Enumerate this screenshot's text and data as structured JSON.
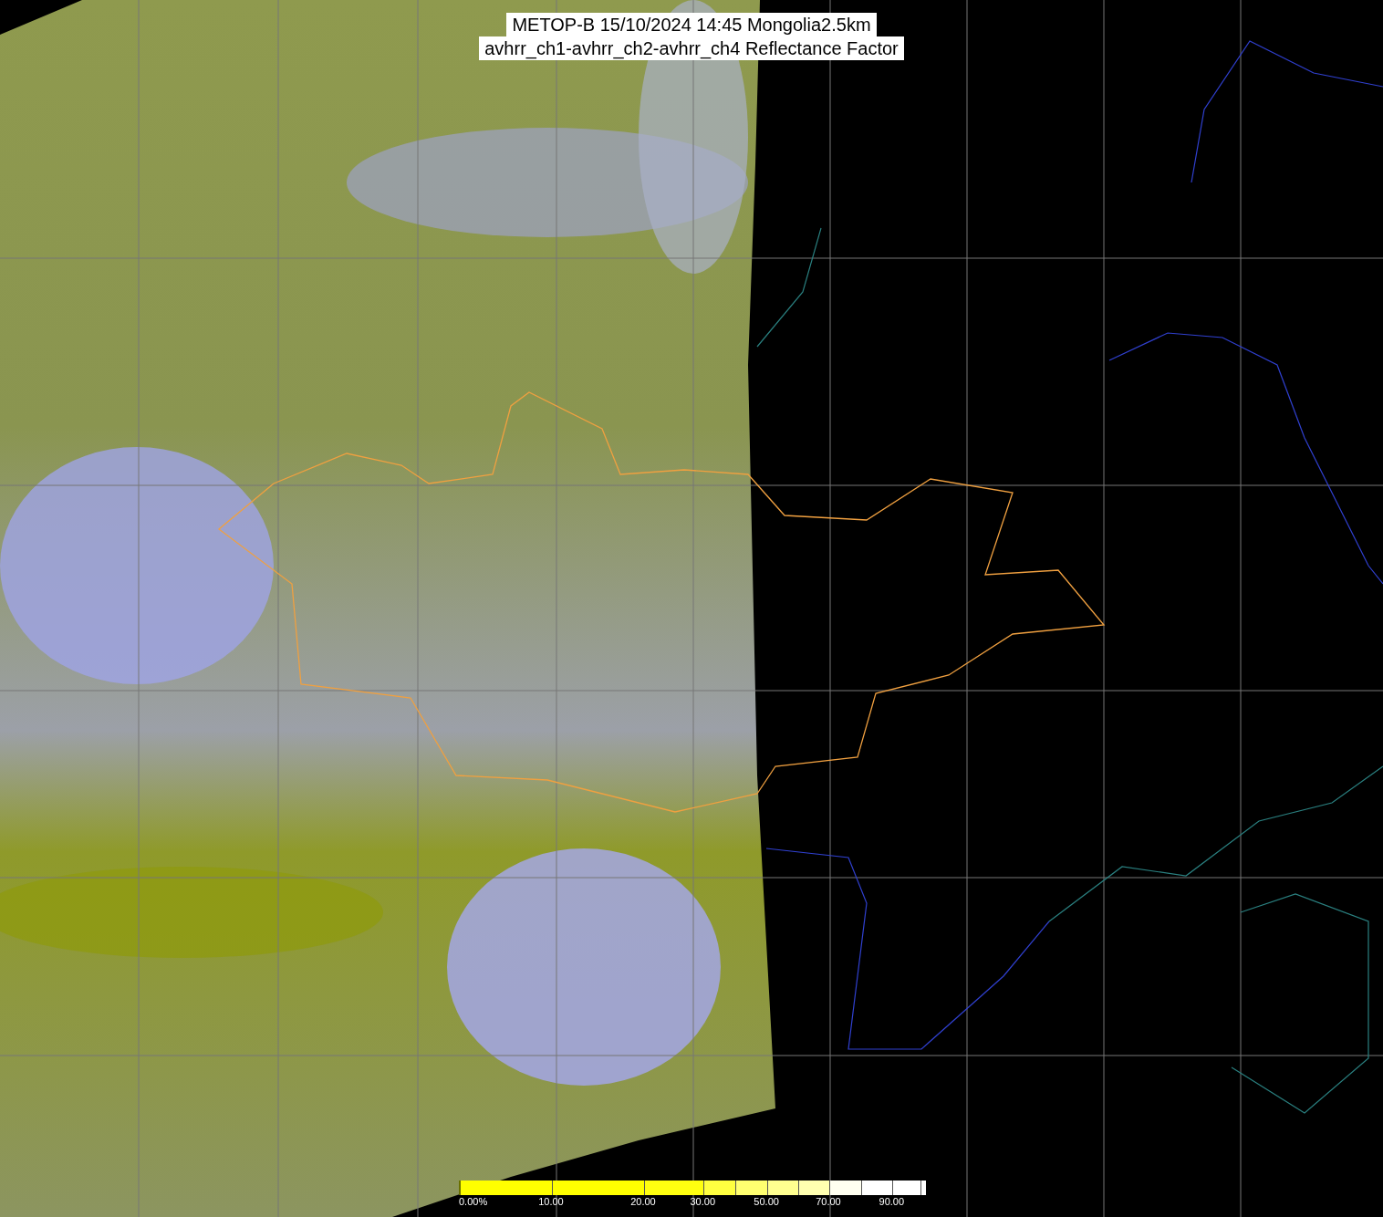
{
  "title": {
    "lines": [
      "METOP-B 15/10/2024 14:45 Mongolia2.5km",
      "avhrr_ch1-avhrr_ch2-avhrr_ch4 Reflectance Factor"
    ]
  },
  "colorbar": {
    "labels": [
      "0.00%",
      "10.00",
      "20.00",
      "30.00",
      "50.00",
      "70.00",
      "90.00"
    ]
  }
}
